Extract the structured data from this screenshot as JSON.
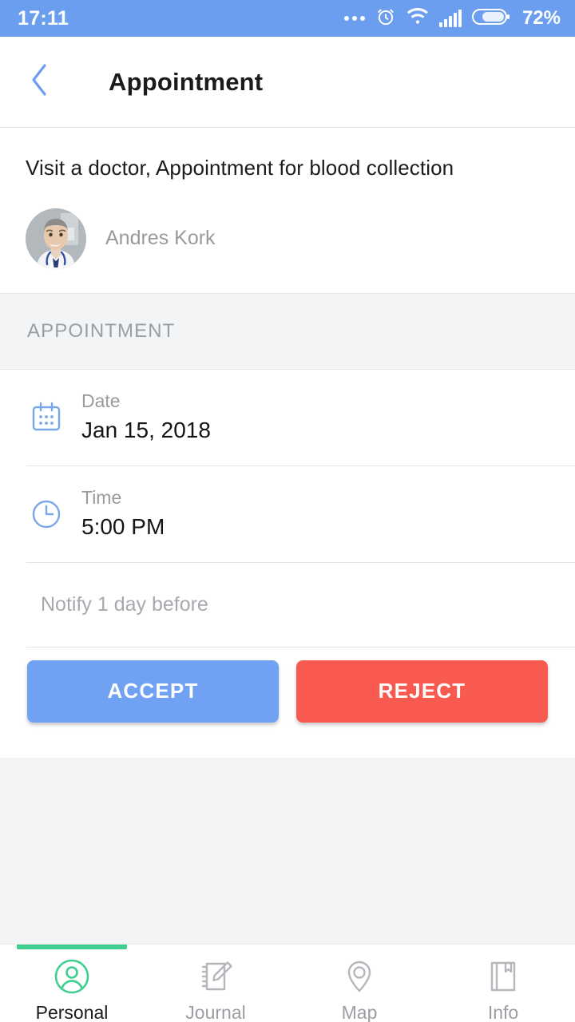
{
  "status_bar": {
    "time": "17:11",
    "battery_percent": "72%",
    "icons": [
      "more-dots-icon",
      "alarm-clock-icon",
      "wifi-icon",
      "signal-bars-icon",
      "battery-icon"
    ],
    "background_color": "#6c9ef0"
  },
  "appbar": {
    "back_icon": "back-chevron-icon",
    "title": "Appointment"
  },
  "summary": {
    "title": "Visit a doctor, Appointment for blood collection",
    "person_name": "Andres Kork",
    "avatar_icon": "doctor-portrait-avatar"
  },
  "section": {
    "header": "APPOINTMENT"
  },
  "details": [
    {
      "icon": "calendar-icon",
      "label": "Date",
      "value": "Jan 15, 2018"
    },
    {
      "icon": "clock-icon",
      "label": "Time",
      "value": "5:00 PM"
    }
  ],
  "notify": {
    "text": "Notify 1 day before"
  },
  "actions": {
    "accept_label": "ACCEPT",
    "accept_color": "#70a1f3",
    "reject_label": "REJECT",
    "reject_color": "#f95a4f"
  },
  "bottom_nav": {
    "active_index": 0,
    "active_color": "#3ecf8e",
    "items": [
      {
        "label": "Personal",
        "icon": "person-circle-icon"
      },
      {
        "label": "Journal",
        "icon": "notebook-pencil-icon"
      },
      {
        "label": "Map",
        "icon": "location-pin-icon"
      },
      {
        "label": "Info",
        "icon": "book-bookmark-icon"
      }
    ]
  }
}
